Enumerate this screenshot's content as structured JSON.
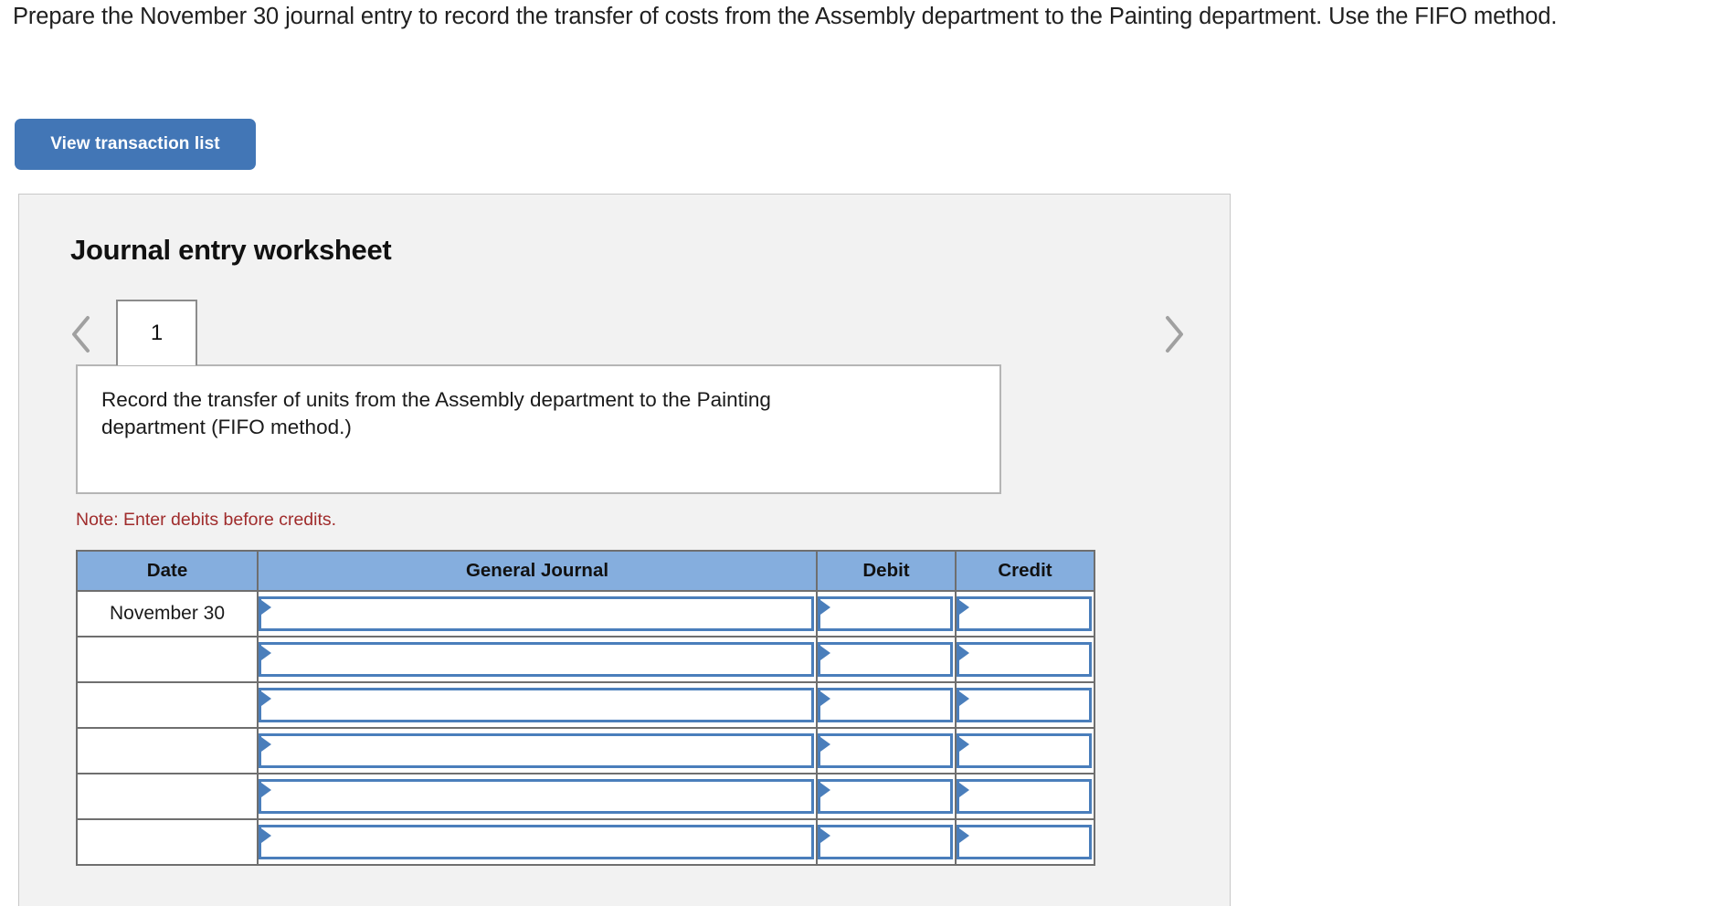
{
  "prompt": "Prepare the November 30 journal entry to record the transfer of costs from the Assembly department to the Painting department. Use the FIFO method.",
  "toolbar": {
    "view_transaction_list_label": "View transaction list"
  },
  "worksheet": {
    "title": "Journal entry worksheet",
    "nav": {
      "prev_icon": "chevron-left-icon",
      "next_icon": "chevron-right-icon"
    },
    "tabs": [
      {
        "label": "1",
        "active": true
      }
    ],
    "description": "Record the transfer of units from the Assembly department to the Painting department (FIFO method.)",
    "note": "Note: Enter debits before credits."
  },
  "journal_table": {
    "columns": [
      "Date",
      "General Journal",
      "Debit",
      "Credit"
    ],
    "rows": [
      {
        "date": "November 30",
        "general_journal": "",
        "debit": "",
        "credit": ""
      },
      {
        "date": "",
        "general_journal": "",
        "debit": "",
        "credit": ""
      },
      {
        "date": "",
        "general_journal": "",
        "debit": "",
        "credit": ""
      },
      {
        "date": "",
        "general_journal": "",
        "debit": "",
        "credit": ""
      },
      {
        "date": "",
        "general_journal": "",
        "debit": "",
        "credit": ""
      },
      {
        "date": "",
        "general_journal": "",
        "debit": "",
        "credit": ""
      }
    ]
  },
  "colors": {
    "button_blue": "#4276b6",
    "header_blue": "#85aede",
    "dropdown_border_blue": "#4a7ebb",
    "note_red": "#a02c2c",
    "panel_bg": "#f2f2f2"
  }
}
